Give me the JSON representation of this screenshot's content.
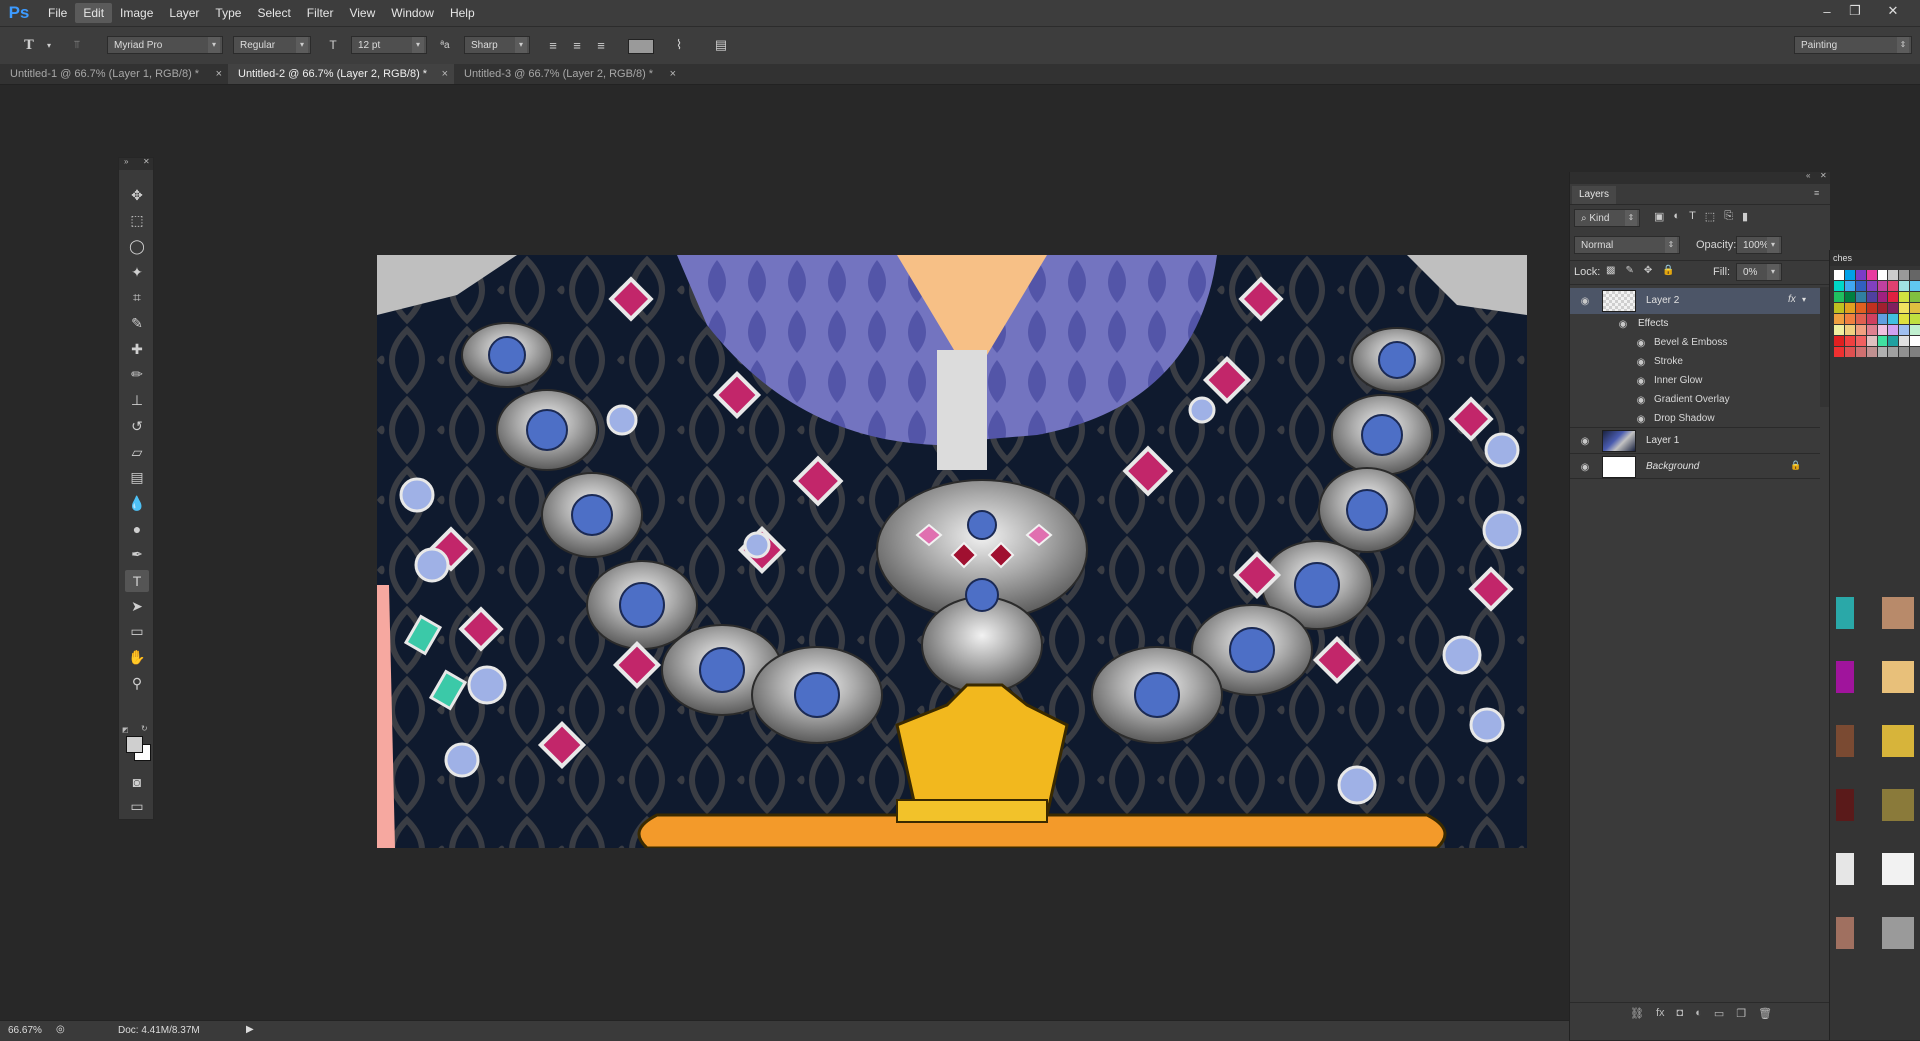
{
  "app": {
    "logo": "Ps",
    "accent": "#3d9bff"
  },
  "menu": [
    "File",
    "Edit",
    "Image",
    "Layer",
    "Type",
    "Select",
    "Filter",
    "View",
    "Window",
    "Help"
  ],
  "menu_active_index": 1,
  "window_controls": {
    "minimize": "–",
    "restore": "❐",
    "close": "✕"
  },
  "options": {
    "font_family": "Myriad Pro",
    "font_style": "Regular",
    "font_size": "12 pt",
    "antialias_icon": "ªa",
    "antialias": "Sharp",
    "workspace": "Painting"
  },
  "tabs": [
    {
      "label": "Untitled-1 @ 66.7% (Layer 1, RGB/8) *",
      "active": false
    },
    {
      "label": "Untitled-2 @ 66.7% (Layer 2, RGB/8) *",
      "active": true
    },
    {
      "label": "Untitled-3 @ 66.7% (Layer 2, RGB/8) *",
      "active": false
    }
  ],
  "tab_close": "×",
  "tools": [
    "move-tool",
    "marquee-tool",
    "lasso-tool",
    "magic-wand-tool",
    "crop-tool",
    "eyedropper-tool",
    "healing-brush-tool",
    "brush-tool",
    "clone-stamp-tool",
    "history-brush-tool",
    "eraser-tool",
    "gradient-tool",
    "blur-tool",
    "dodge-tool",
    "pen-tool",
    "type-tool",
    "path-selection-tool",
    "rectangle-tool",
    "hand-tool",
    "zoom-tool"
  ],
  "layers_panel": {
    "tab": "Layers",
    "filter": "Kind",
    "blend_mode": "Normal",
    "opacity_label": "Opacity:",
    "opacity": "100%",
    "lock_label": "Lock:",
    "fill_label": "Fill:",
    "fill": "0%",
    "layers": [
      {
        "name": "Layer 2",
        "selected": true,
        "fx": "fx"
      },
      {
        "name": "Layer 1",
        "selected": false
      },
      {
        "name": "Background",
        "selected": false
      }
    ],
    "effects_label": "Effects",
    "effects": [
      "Bevel & Emboss",
      "Stroke",
      "Inner Glow",
      "Gradient Overlay",
      "Drop Shadow"
    ]
  },
  "swatches_tab": "ches",
  "status": {
    "zoom": "66.67%",
    "doc": "Doc: 4.41M/8.37M"
  }
}
